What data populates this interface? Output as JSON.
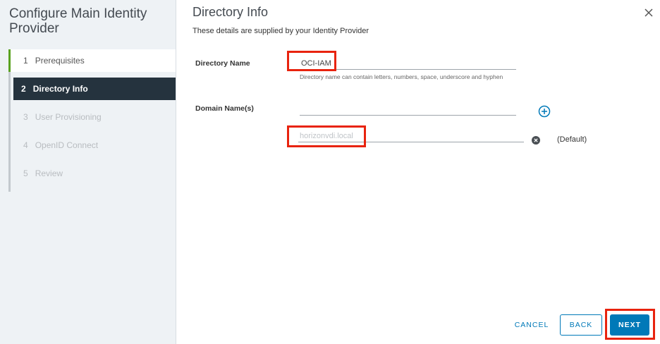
{
  "wizard": {
    "title": "Configure Main Identity Provider",
    "steps": [
      {
        "num": "1",
        "label": "Prerequisites",
        "state": "done"
      },
      {
        "num": "2",
        "label": "Directory Info",
        "state": "active"
      },
      {
        "num": "3",
        "label": "User Provisioning",
        "state": "disabled"
      },
      {
        "num": "4",
        "label": "OpenID Connect",
        "state": "disabled"
      },
      {
        "num": "5",
        "label": "Review",
        "state": "disabled"
      }
    ]
  },
  "main": {
    "title": "Directory Info",
    "subtitle": "These details are supplied by your Identity Provider",
    "directory_name": {
      "label": "Directory Name",
      "value": "OCI-IAM",
      "helper": "Directory name can contain letters, numbers, space, underscore and hyphen"
    },
    "domain_names": {
      "label": "Domain Name(s)",
      "new_value": "",
      "existing_placeholder": "horizonvdi.local",
      "default_tag": "(Default)"
    }
  },
  "footer": {
    "cancel_label": "CANCEL",
    "back_label": "BACK",
    "next_label": "NEXT"
  },
  "colors": {
    "accent": "#0079b8",
    "highlight": "#e8230e",
    "active_step_bg": "#25333e",
    "done_step_marker": "#5aa220"
  },
  "icons": [
    "close-icon",
    "add-circle-icon",
    "remove-circle-icon"
  ]
}
